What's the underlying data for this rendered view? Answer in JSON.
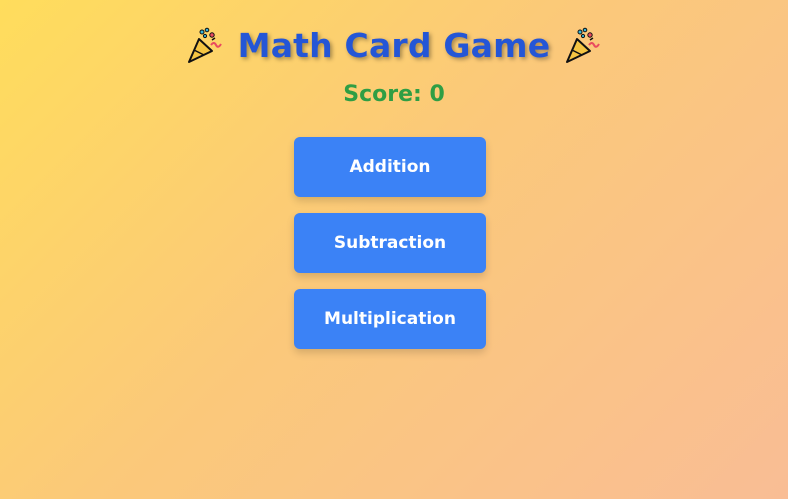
{
  "header": {
    "title": "Math Card Game",
    "left_icon": "party-popper-icon",
    "right_icon": "party-popper-icon"
  },
  "score": {
    "text": "Score: 0",
    "value": 0
  },
  "menu": {
    "items": [
      {
        "label": "Addition"
      },
      {
        "label": "Subtraction"
      },
      {
        "label": "Multiplication"
      }
    ]
  },
  "colors": {
    "title": "#2456d6",
    "score": "#2f9e44",
    "button": "#3b82f6",
    "button_text": "#ffffff",
    "background_start": "#ffdd5c",
    "background_end": "#f9bd95"
  }
}
